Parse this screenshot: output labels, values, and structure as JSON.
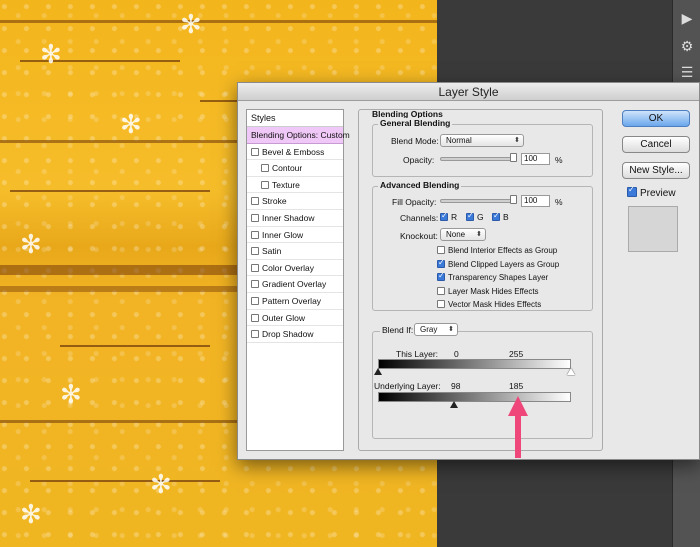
{
  "window": {
    "title": "Layer Style"
  },
  "styles_panel": {
    "header": "Styles",
    "items": [
      {
        "label": "Blending Options: Custom",
        "checkbox": false,
        "checked": false,
        "selected": true,
        "sub": false
      },
      {
        "label": "Bevel & Emboss",
        "checkbox": true,
        "checked": false,
        "selected": false,
        "sub": false
      },
      {
        "label": "Contour",
        "checkbox": true,
        "checked": false,
        "selected": false,
        "sub": true
      },
      {
        "label": "Texture",
        "checkbox": true,
        "checked": false,
        "selected": false,
        "sub": true
      },
      {
        "label": "Stroke",
        "checkbox": true,
        "checked": false,
        "selected": false,
        "sub": false
      },
      {
        "label": "Inner Shadow",
        "checkbox": true,
        "checked": false,
        "selected": false,
        "sub": false
      },
      {
        "label": "Inner Glow",
        "checkbox": true,
        "checked": false,
        "selected": false,
        "sub": false
      },
      {
        "label": "Satin",
        "checkbox": true,
        "checked": false,
        "selected": false,
        "sub": false
      },
      {
        "label": "Color Overlay",
        "checkbox": true,
        "checked": false,
        "selected": false,
        "sub": false
      },
      {
        "label": "Gradient Overlay",
        "checkbox": true,
        "checked": false,
        "selected": false,
        "sub": false
      },
      {
        "label": "Pattern Overlay",
        "checkbox": true,
        "checked": false,
        "selected": false,
        "sub": false
      },
      {
        "label": "Outer Glow",
        "checkbox": true,
        "checked": false,
        "selected": false,
        "sub": false
      },
      {
        "label": "Drop Shadow",
        "checkbox": true,
        "checked": false,
        "selected": false,
        "sub": false
      }
    ]
  },
  "blending_options": {
    "title": "Blending Options",
    "general": {
      "title": "General Blending",
      "blend_mode_label": "Blend Mode:",
      "blend_mode_value": "Normal",
      "opacity_label": "Opacity:",
      "opacity_value": "100",
      "opacity_unit": "%",
      "opacity_level": 1.0
    },
    "advanced": {
      "title": "Advanced Blending",
      "fill_opacity_label": "Fill Opacity:",
      "fill_opacity_value": "100",
      "fill_opacity_unit": "%",
      "fill_opacity_level": 1.0,
      "channels_label": "Channels:",
      "channels": [
        {
          "label": "R",
          "checked": true
        },
        {
          "label": "G",
          "checked": true
        },
        {
          "label": "B",
          "checked": true
        }
      ],
      "knockout_label": "Knockout:",
      "knockout_value": "None",
      "options": [
        {
          "label": "Blend Interior Effects as Group",
          "checked": false
        },
        {
          "label": "Blend Clipped Layers as Group",
          "checked": true
        },
        {
          "label": "Transparency Shapes Layer",
          "checked": true
        },
        {
          "label": "Layer Mask Hides Effects",
          "checked": false
        },
        {
          "label": "Vector Mask Hides Effects",
          "checked": false
        }
      ]
    },
    "blend_if": {
      "label": "Blend If:",
      "value": "Gray",
      "this_layer": {
        "label": "This Layer:",
        "low": "0",
        "high": "255"
      },
      "underlying_layer": {
        "label": "Underlying Layer:",
        "low": "98",
        "high": "185"
      }
    }
  },
  "buttons": {
    "ok": "OK",
    "cancel": "Cancel",
    "new_style": "New Style...",
    "preview_label": "Preview",
    "preview_checked": true
  },
  "toolbar": {
    "icons": [
      "play-icon",
      "brush-preset-icon",
      "adjust-sliders-icon"
    ]
  },
  "colors": {
    "accent": "#3b7ad9",
    "annotation_arrow": "#f0477a",
    "selection": "#f0c8f7",
    "canvas": "#f3b51c"
  }
}
